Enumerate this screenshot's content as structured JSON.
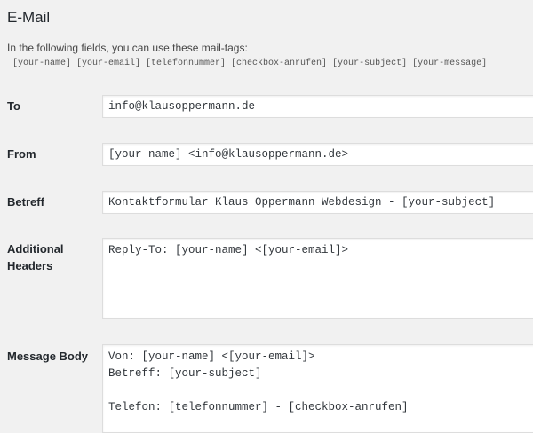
{
  "section": {
    "title": "E-Mail",
    "intro": "In the following fields, you can use these mail-tags:",
    "mail_tags": "[your-name] [your-email] [telefonnummer] [checkbox-anrufen] [your-subject] [your-message]"
  },
  "fields": {
    "to": {
      "label": "To",
      "value": "info@klausoppermann.de"
    },
    "from": {
      "label": "From",
      "value": "[your-name] <info@klausoppermann.de>"
    },
    "betreff": {
      "label": "Betreff",
      "value": "Kontaktformular Klaus Oppermann Webdesign - [your-subject]"
    },
    "additional_headers": {
      "label_line1": "Additional",
      "label_line2": "Headers",
      "value": "Reply-To: [your-name] <[your-email]>"
    },
    "message_body": {
      "label": "Message Body",
      "value": "Von: [your-name] <[your-email]>\nBetreff: [your-subject]\n\nTelefon: [telefonnummer] - [checkbox-anrufen]"
    }
  }
}
